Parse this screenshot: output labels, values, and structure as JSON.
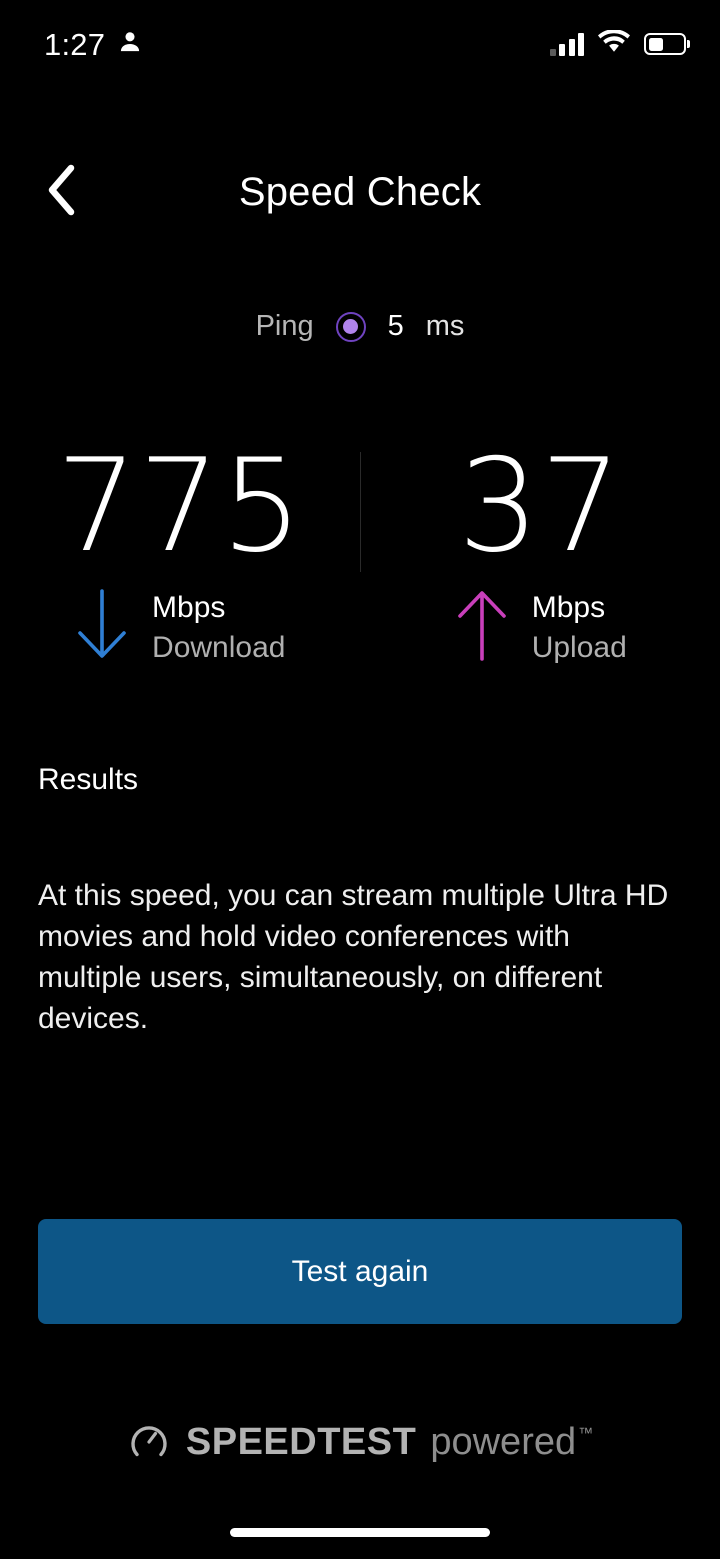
{
  "status_bar": {
    "time": "1:27",
    "account_icon": "person-icon",
    "signal_icon": "cellular-signal-icon",
    "wifi_icon": "wifi-icon",
    "battery_icon": "battery-icon",
    "battery_level_percent": 45
  },
  "header": {
    "back_icon": "chevron-left-icon",
    "title": "Speed Check"
  },
  "ping": {
    "label": "Ping",
    "indicator_icon": "ping-dot-icon",
    "value": "5",
    "unit": "ms",
    "accent_color": "#b184ec"
  },
  "speeds": {
    "download": {
      "value": "775",
      "unit": "Mbps",
      "direction": "Download",
      "arrow_icon": "arrow-down-icon",
      "accent_color": "#2f7fd4"
    },
    "upload": {
      "value": "37",
      "unit": "Mbps",
      "direction": "Upload",
      "arrow_icon": "arrow-up-icon",
      "accent_color": "#c93fbb"
    }
  },
  "results": {
    "title": "Results",
    "description": "At this speed, you can stream multiple Ultra HD movies and hold video conferences with multiple users, simultaneously, on different devices."
  },
  "cta": {
    "label": "Test again",
    "color": "#0d5687"
  },
  "footer": {
    "logo_icon": "speedtest-gauge-icon",
    "brand": "SPEEDTEST",
    "tagline": "powered",
    "trademark": "™"
  }
}
